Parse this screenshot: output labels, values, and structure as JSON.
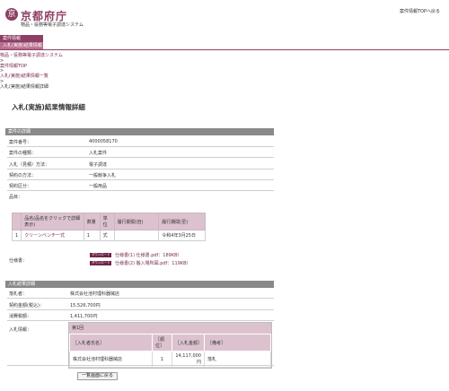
{
  "header": {
    "logo_emblem": "京",
    "logo_text": "京都府庁",
    "logo_sub": "物品・役務等電子調達システム",
    "top_link": "案件情報TOPへ戻る"
  },
  "nav": {
    "item": "案件情報",
    "sub_item": "入札(実施)結果情報"
  },
  "breadcrumb": {
    "items": [
      "物品・役務等電子調達システム",
      "案件情報TOP",
      "入札(実施)結果情報一覧"
    ],
    "separator": ">",
    "current": "入札(実施)結果情報詳細"
  },
  "page_title": "入札(実施)結果情報詳細",
  "case_section": {
    "title": "案件の詳細",
    "fields": [
      {
        "label": "案件番号：",
        "value": "4000058170"
      },
      {
        "label": "案件の種類：",
        "value": "入札案件"
      },
      {
        "label": "入札（見積）方法：",
        "value": "電子調達"
      },
      {
        "label": "契約の方法：",
        "value": "一般競争入札"
      },
      {
        "label": "契約区分：",
        "value": "一般用品"
      }
    ],
    "items_label": "品目：",
    "items_table": {
      "headers": [
        "",
        "品名(品名をクリックで詳細表示)",
        "数量",
        "単位",
        "履行期間(自)",
        "履行期間(至)"
      ],
      "rows": [
        {
          "no": "1",
          "name": "クリーンベンチ一式",
          "qty": "1",
          "unit": "式",
          "from": "",
          "to": "令和4年3月25日"
        }
      ]
    },
    "spec_label": "仕様書：",
    "spec_files": [
      {
        "badge": "ダウンロード",
        "name": "仕様書(1) 仕様書.pdf：189KB）"
      },
      {
        "badge": "ダウンロード",
        "name": "仕様書(2) 搬入場所図.pdf：119KB）"
      }
    ]
  },
  "result_section": {
    "title": "入札結果詳細",
    "fields": [
      {
        "label": "落札者：",
        "value": "株式会社池村理科器械店"
      },
      {
        "label": "契約金額(税込)：",
        "value": "15,526,700円"
      },
      {
        "label": "消費税額：",
        "value": "1,411,700円"
      }
    ],
    "bid_label": "入札情報：",
    "round": "第1回",
    "bid_headers": [
      "［入札者氏名］",
      "［順位］",
      "［入札金額］",
      "［備考］"
    ],
    "bids": [
      {
        "name": "株式会社池村理科器械店",
        "rank": "1",
        "amount": "14,117,000円",
        "note": "落札"
      }
    ]
  },
  "back_button": "一覧画面に戻る",
  "colors": {
    "brand": "#8e3f63",
    "section_header": "#888a87",
    "table_header": "#dcc2cf"
  }
}
